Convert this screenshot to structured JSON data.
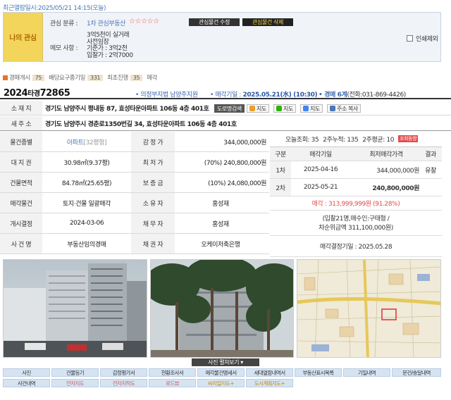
{
  "recent_view": "최근열람일시:2025/05/21 14:15(오늘)",
  "favorite": {
    "label": "나의 관심",
    "category_key": "관심 분류 :",
    "category_value": "1차 관심부동산",
    "stars": "☆☆☆☆☆",
    "btn_edit": "관심물건 수정",
    "btn_delete": "관심물건 삭제",
    "memo_key": "메모 사항 :",
    "memo_lines": [
      "3억5천이 실거래",
      "사전임장",
      "기준가 : 3억2천",
      "입찰가 : 2억7000"
    ],
    "print_label": "인쇄제외"
  },
  "stats": {
    "views_label": "경매개시",
    "views": "75",
    "dividend_label": "배당요구종기일",
    "dividend": "331",
    "last_label": "최초진행",
    "last": "35",
    "sale_label": "매각"
  },
  "case": {
    "year": "2024",
    "type": "타경",
    "number": "72865",
    "court": "• 의정부지법 남양주지원",
    "sale_prefix": "• 매각기일 :",
    "sale_date": "2025.05.21(水) (10:30)",
    "dept_prefix": "• 경매 6계",
    "tel": "(전화:031-869-4426)"
  },
  "address": {
    "lot_label": "소 재 지",
    "lot": "경기도 남양주시 평내동 87, 효성타운아파트 106동 4층 401호",
    "road_btn": "도로명검색",
    "map1": "지도",
    "map2": "지도",
    "map3": "지도",
    "copy": "주소 복사",
    "road_label": "새 주 소",
    "road": "경기도 남양주시 경춘로1350번길 34, 효성타운아파트 106동 4층 401호"
  },
  "info": {
    "rows": [
      {
        "k1": "물건종별",
        "v1": "아파트",
        "v1b": "[32평형]",
        "k2": "감 정 가",
        "v2": "344,000,000원"
      },
      {
        "k1": "대 지 권",
        "v1": "30.98㎡(9.37평)",
        "k2": "최 저 가",
        "v2": "(70%) 240,800,000원"
      },
      {
        "k1": "건물면적",
        "v1": "84.78㎡(25.65평)",
        "k2": "보 증 금",
        "v2": "(10%) 24,080,000원"
      },
      {
        "k1": "매각물건",
        "v1": "토지·건물 일괄매각",
        "k2": "소 유 자",
        "v2": "홍성재"
      },
      {
        "k1": "개시결정",
        "v1": "2024-03-06",
        "k2": "채 무 자",
        "v2": "홍성재"
      },
      {
        "k1": "사 건 명",
        "v1": "부동산임의경매",
        "k2": "채 권 자",
        "v2": "오케이저축은행"
      }
    ]
  },
  "views": {
    "today": "오늘조회: 35",
    "two_week": "2주누적: 135",
    "avg": "2주평균: 10",
    "trend_btn": "조회동향"
  },
  "history": {
    "headers": [
      "구분",
      "매각기일",
      "최저매각가격",
      "결과"
    ],
    "rows": [
      {
        "round": "1차",
        "date": "2025-04-16",
        "price": "344,000,000원",
        "result": "유찰"
      },
      {
        "round": "2차",
        "date": "2025-05-21",
        "price": "240,800,000원",
        "result": ""
      }
    ],
    "sold": "매각 : 313,999,999원  (91.28%)",
    "bidders": "(입찰21명,매수인:구태형 /",
    "second": "차순위금액 311,100,000원)",
    "confirm": "매각결정기일 : 2025.05.28"
  },
  "photo_toggle": "사진 펼쳐보기 ▾",
  "nav_row1": [
    "사진",
    "건물등기",
    "감정평가서",
    "현황조사서",
    "매각물건명세서",
    "세대열람내역서",
    "부동산표시목록",
    "기일내역",
    "문건/송달내역"
  ],
  "nav_row2": [
    "사건내역",
    "전자지도",
    "전자지적도",
    "로드뷰",
    "씨리얼지도+",
    "도시계획지도+"
  ],
  "colors": {
    "accent": "#3a67b0",
    "fav_label_bg": "#f2d55a",
    "sold_red": "#e34b4b",
    "nav_bg": "#d6e4f2"
  }
}
